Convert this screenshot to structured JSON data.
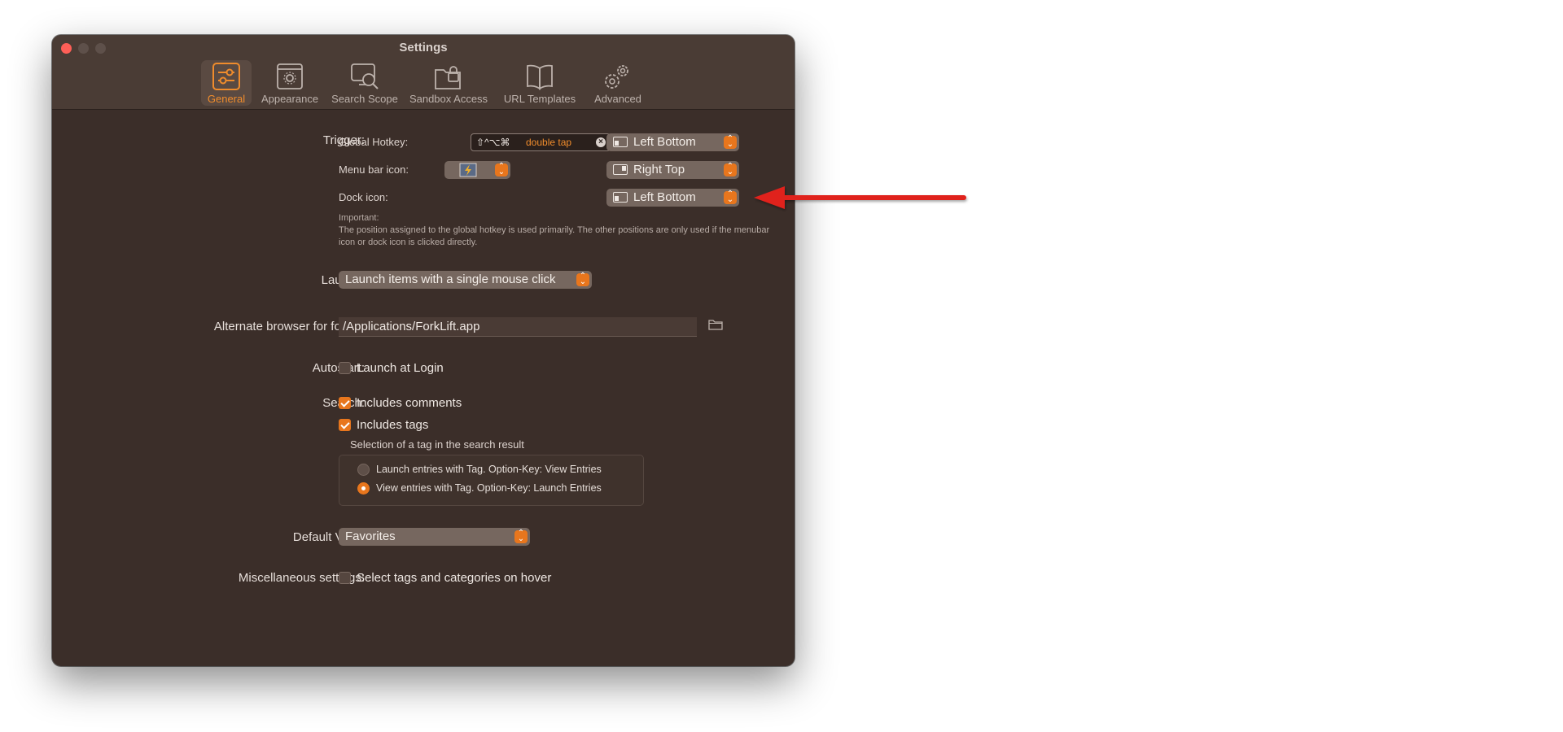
{
  "window": {
    "title": "Settings"
  },
  "toolbar": {
    "tabs": [
      {
        "label": "General",
        "icon": "sliders-icon",
        "active": true
      },
      {
        "label": "Appearance",
        "icon": "appearance-icon",
        "active": false
      },
      {
        "label": "Search Scope",
        "icon": "search-scope-icon",
        "active": false
      },
      {
        "label": "Sandbox Access",
        "icon": "lock-folder-icon",
        "active": false
      },
      {
        "label": "URL Templates",
        "icon": "book-icon",
        "active": false
      },
      {
        "label": "Advanced",
        "icon": "gears-icon",
        "active": false
      }
    ]
  },
  "trigger": {
    "label": "Trigger:",
    "global_hotkey": {
      "label": "Global Hotkey:",
      "keys": "⇧^⌥⌘",
      "tap": "double tap",
      "position": "Left Bottom"
    },
    "menu_bar_icon": {
      "label": "Menu bar icon:",
      "position": "Right Top"
    },
    "dock_icon": {
      "label": "Dock icon:",
      "position": "Left Bottom"
    },
    "note_title": "Important:",
    "note_body": "The position assigned to the global hotkey is used primarily. The other positions are only used if the menubar icon or dock icon is clicked directly."
  },
  "launch": {
    "label": "Launch:",
    "value": "Launch items with a single mouse click"
  },
  "alternate_browser": {
    "label": "Alternate browser for folder:",
    "value": "/Applications/ForkLift.app"
  },
  "autostart": {
    "label": "Autostart:",
    "option": "Launch at Login",
    "checked": false
  },
  "search": {
    "label": "Search:",
    "includes_comments": {
      "label": "Includes comments",
      "checked": true
    },
    "includes_tags": {
      "label": "Includes tags",
      "checked": true
    },
    "tag_selection": {
      "title": "Selection of a tag in the search result",
      "options": [
        {
          "label": "Launch entries with Tag. Option-Key: View Entries",
          "selected": false
        },
        {
          "label": "View entries with Tag. Option-Key: Launch Entries",
          "selected": true
        }
      ]
    }
  },
  "default_view": {
    "label": "Default View:",
    "value": "Favorites"
  },
  "misc": {
    "label": "Miscellaneous settings:",
    "option": "Select tags and categories on hover",
    "checked": false
  },
  "colors": {
    "accent": "#e8761d",
    "window_bg": "#3b2e29",
    "annotation_arrow": "#e0201b"
  }
}
